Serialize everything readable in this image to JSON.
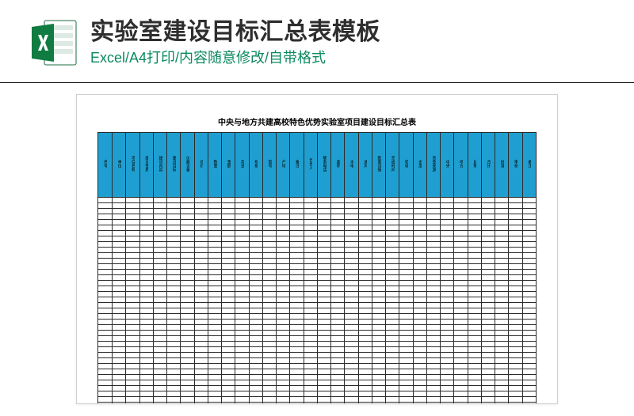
{
  "header": {
    "main_title": "实验室建设目标汇总表模板",
    "subtitle": "Excel/A4打印/内容随意修改/自带格式"
  },
  "sheet": {
    "title": "中央与地方共建高校特色优势实验室项目建设目标汇总表",
    "column_count": 32,
    "body_row_count": 40,
    "header_labels": [
      "序号",
      "单位",
      "项目名称",
      "建设性质",
      "建设内容",
      "建设目标",
      "仪器设备",
      "总价",
      "数量",
      "金额",
      "用途",
      "规格",
      "型号",
      "产地",
      "备注",
      "负责人",
      "联系电话",
      "面积",
      "水电",
      "通风",
      "配套设施",
      "完成时间",
      "验收",
      "进度",
      "资金来源",
      "中央",
      "地方",
      "自筹",
      "合计",
      "批准",
      "审核",
      "备注"
    ]
  }
}
